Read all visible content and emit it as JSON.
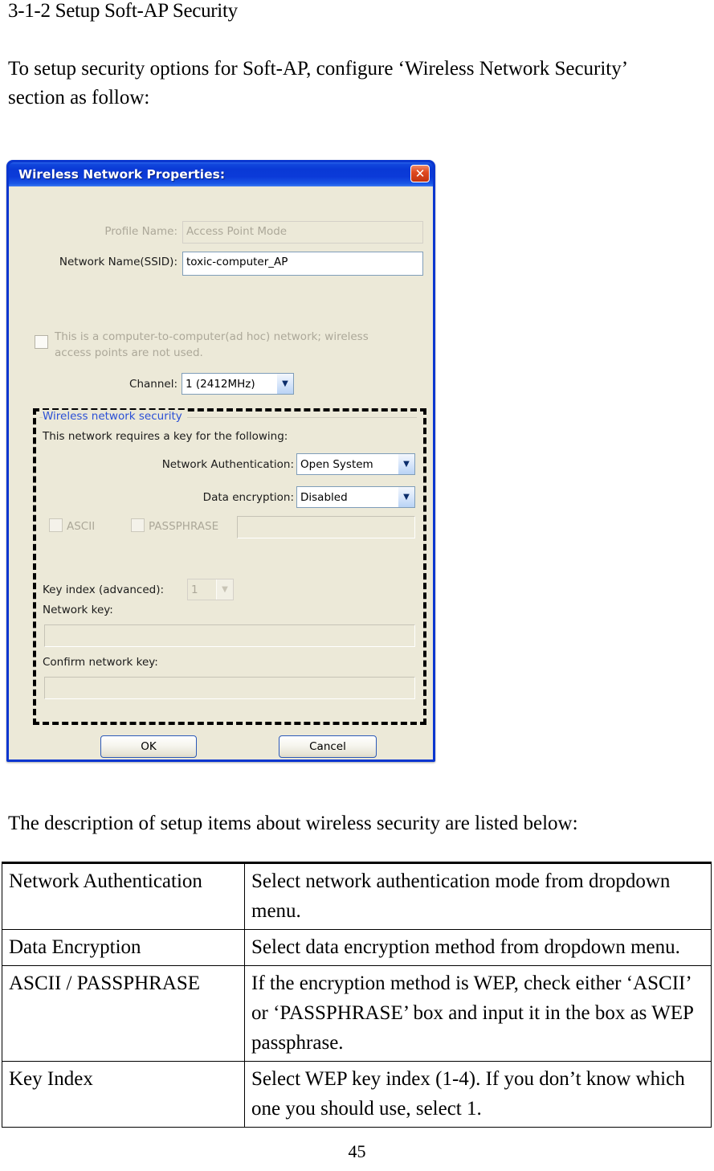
{
  "document": {
    "heading": "3-1-2 Setup Soft-AP Security",
    "intro_paragraph": "To setup security options for Soft-AP, configure ‘Wireless Network Security’ section as follow:",
    "description_paragraph": "The description of setup items about wireless security are listed below:",
    "page_number": "45"
  },
  "dialog": {
    "title": "Wireless Network Properties:",
    "close_icon": "✕",
    "profile_name": {
      "label": "Profile Name:",
      "value": "Access Point Mode"
    },
    "ssid": {
      "label": "Network Name(SSID):",
      "value": "toxic-computer_AP"
    },
    "adhoc": {
      "label": "This is a computer-to-computer(ad hoc) network; wireless access points are not used."
    },
    "channel": {
      "label": "Channel:",
      "value": "1  (2412MHz)"
    },
    "security": {
      "group_title": "Wireless network security",
      "requires_key_text": "This network requires a key for the following:",
      "network_authentication": {
        "label": "Network Authentication:",
        "value": "Open System"
      },
      "data_encryption": {
        "label": "Data encryption:",
        "value": "Disabled"
      },
      "ascii_label": "ASCII",
      "passphrase_label": "PASSPHRASE",
      "passphrase_value": "",
      "key_index": {
        "label": "Key index (advanced):",
        "value": "1"
      },
      "network_key": {
        "label": "Network key:",
        "value": ""
      },
      "confirm_network_key": {
        "label": "Confirm network key:",
        "value": ""
      }
    },
    "buttons": {
      "ok": "OK",
      "cancel": "Cancel"
    },
    "arrow_glyph": "▼"
  },
  "table": {
    "rows": [
      {
        "item": "Network Authentication",
        "description": "Select network authentication mode from dropdown menu."
      },
      {
        "item": "Data Encryption",
        "description": "Select data encryption method from dropdown menu."
      },
      {
        "item": "ASCII / PASSPHRASE",
        "description": "If the encryption method is WEP, check either ‘ASCII’ or ‘PASSPHRASE’ box and input it in the box as WEP passphrase."
      },
      {
        "item": "Key Index",
        "description": "Select WEP key index (1-4). If you don’t know which one you should use, select 1."
      }
    ]
  },
  "colors": {
    "title_bar_blue": "#0a39d6",
    "dialog_face": "#ece9d8",
    "group_title_blue": "#2a4fd6",
    "close_red": "#e04a21"
  }
}
